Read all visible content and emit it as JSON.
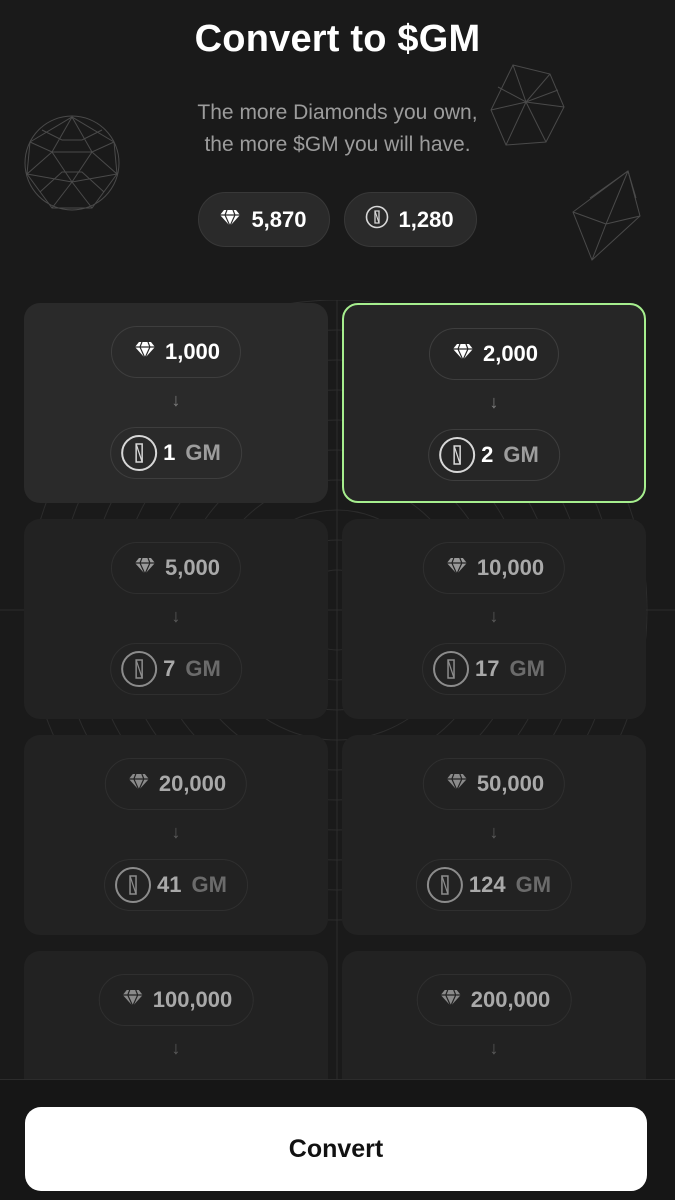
{
  "header": {
    "title": "Convert to $GM",
    "subtitle_line1": "The more Diamonds you own,",
    "subtitle_line2": "the more $GM you will have."
  },
  "balances": {
    "diamonds": "5,870",
    "gm": "1,280"
  },
  "options": [
    {
      "diamonds": "1,000",
      "gm_amount": "1",
      "gm_unit": "GM",
      "state": "normal"
    },
    {
      "diamonds": "2,000",
      "gm_amount": "2",
      "gm_unit": "GM",
      "state": "selected"
    },
    {
      "diamonds": "5,000",
      "gm_amount": "7",
      "gm_unit": "GM",
      "state": "disabled"
    },
    {
      "diamonds": "10,000",
      "gm_amount": "17",
      "gm_unit": "GM",
      "state": "disabled"
    },
    {
      "diamonds": "20,000",
      "gm_amount": "41",
      "gm_unit": "GM",
      "state": "disabled"
    },
    {
      "diamonds": "50,000",
      "gm_amount": "124",
      "gm_unit": "GM",
      "state": "disabled"
    },
    {
      "diamonds": "100,000",
      "gm_amount": "",
      "gm_unit": "",
      "state": "disabled"
    },
    {
      "diamonds": "200,000",
      "gm_amount": "",
      "gm_unit": "",
      "state": "disabled"
    }
  ],
  "footer": {
    "convert_label": "Convert"
  },
  "colors": {
    "background": "#1a1a1a",
    "selected_border": "#a6ee8e",
    "button_bg": "#ffffff"
  }
}
